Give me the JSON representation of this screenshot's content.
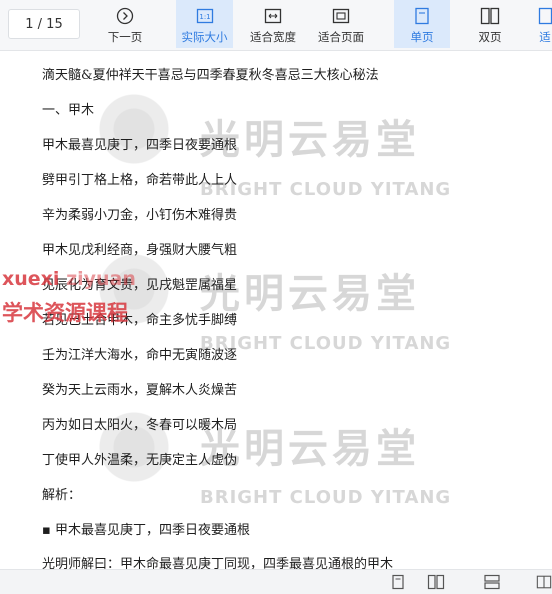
{
  "toolbar": {
    "page_indicator": "1  / 15",
    "buttons": [
      {
        "id": "next-page",
        "label": "下一页"
      },
      {
        "id": "actual-size",
        "label": "实际大小"
      },
      {
        "id": "fit-width",
        "label": "适合宽度"
      },
      {
        "id": "fit-page",
        "label": "适合页面"
      },
      {
        "id": "single-page",
        "label": "单页"
      },
      {
        "id": "double-page",
        "label": "双页"
      },
      {
        "id": "cut",
        "label": "适"
      }
    ],
    "accent_color": "#2f7be0"
  },
  "document": {
    "title": "滴天髓&夏仲祥天干喜忌与四季春夏秋冬喜忌三大核心秘法",
    "section": "一、甲木",
    "lines": [
      "甲木最喜见庚丁，四季日夜要通根",
      "劈甲引丁格上格，命若带此人上人",
      "辛为柔弱小刀金，小钉伤木难得贵",
      "甲木见戊利经商，身强财大腰气粗",
      "见辰化为育文贵，见戌魁罡属福星",
      "若见己土合甲木，命主多忧手脚缚",
      "壬为江洋大海水，命中无寅随波逐",
      "癸为天上云雨水，夏解木人炎燥苦",
      "丙为如日太阳火，冬春可以暖木局",
      "丁使甲人外温柔，无庚定主人虚伪"
    ],
    "analysis_label": "解析：",
    "bullet": "▪ 甲木最喜见庚丁，四季日夜要通根",
    "last_line": "光明师解曰：甲木命最喜见庚丁同现，四季最喜见通根的甲木"
  },
  "watermarks": {
    "brand_cn": "光明云易堂",
    "brand_en": "BRIGHT CLOUD YITANG",
    "side_top": "xuexi",
    "side_top_mid": "ziyuan",
    "side_bottom": "学术资源课程",
    "side_color": "#d8383f"
  }
}
